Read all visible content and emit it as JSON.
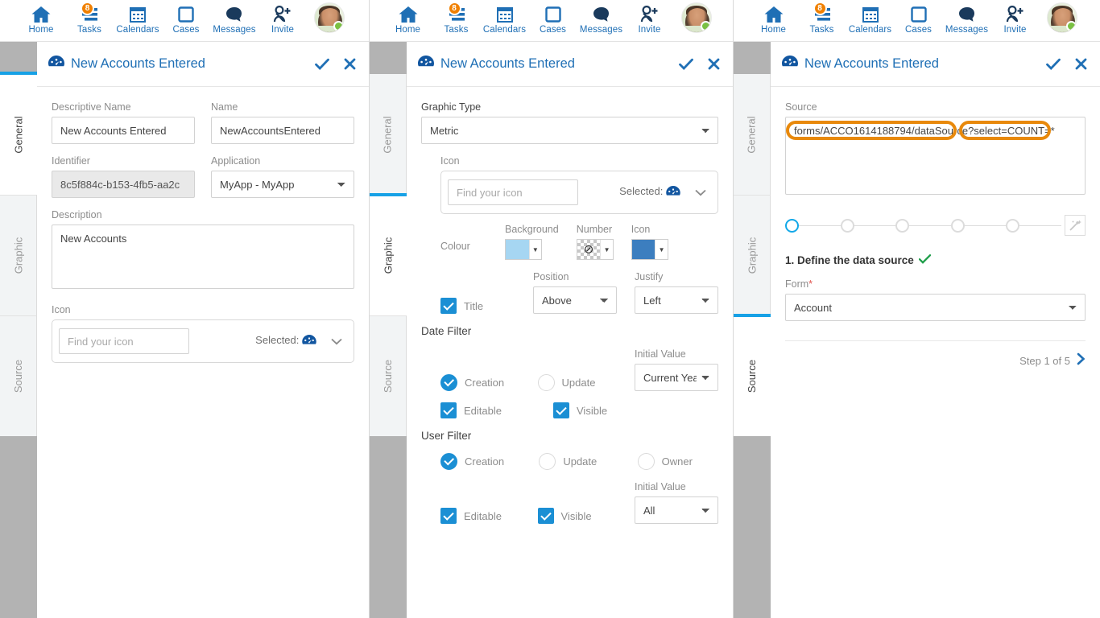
{
  "nav": {
    "items": [
      {
        "label": "Home",
        "icon": "home-icon",
        "badge": null
      },
      {
        "label": "Tasks",
        "icon": "tasks-icon",
        "badge": "8"
      },
      {
        "label": "Calendars",
        "icon": "calendar-icon",
        "badge": null
      },
      {
        "label": "Cases",
        "icon": "cases-icon",
        "badge": null
      },
      {
        "label": "Messages",
        "icon": "message-bubble-icon",
        "badge": null
      },
      {
        "label": "Invite",
        "icon": "invite-user-icon",
        "badge": null
      }
    ],
    "avatar": {
      "name": "avatar",
      "status": "online"
    }
  },
  "window": {
    "title": "New Accounts Entered",
    "icon": "dashboard-gauge-icon",
    "confirm_icon": "checkmark-icon",
    "close_icon": "close-icon"
  },
  "tabs": [
    {
      "label": "General"
    },
    {
      "label": "Graphic"
    },
    {
      "label": "Source"
    }
  ],
  "panel1": {
    "active_tab": "General",
    "descriptive_name": {
      "label": "Descriptive Name",
      "value": "New Accounts Entered"
    },
    "name": {
      "label": "Name",
      "value": "NewAccountsEntered"
    },
    "identifier": {
      "label": "Identifier",
      "value": "8c5f884c-b153-4fb5-aa2c"
    },
    "application": {
      "label": "Application",
      "value": "MyApp - MyApp"
    },
    "description": {
      "label": "Description",
      "value": "New Accounts"
    },
    "icon": {
      "label": "Icon",
      "search_placeholder": "Find your icon",
      "selected_label": "Selected:",
      "selected_icon": "dashboard-gauge-icon"
    }
  },
  "panel2": {
    "active_tab": "Graphic",
    "graphic_type": {
      "label": "Graphic Type",
      "value": "Metric",
      "options": [
        "Metric"
      ]
    },
    "icon": {
      "label": "Icon",
      "search_placeholder": "Find your icon",
      "selected_label": "Selected:",
      "selected_icon": "dashboard-gauge-icon"
    },
    "colour": {
      "label": "Colour",
      "swatches": [
        {
          "caption": "Background",
          "color": "#A6D6F2",
          "transparent": false
        },
        {
          "caption": "Number",
          "color": "transparent",
          "transparent": true
        },
        {
          "caption": "Icon",
          "color": "#3C7EBF",
          "transparent": false
        }
      ]
    },
    "title_row": {
      "checkbox_label": "Title",
      "checkbox_on": true,
      "position": {
        "label": "Position",
        "value": "Above",
        "options": [
          "Above"
        ]
      },
      "justify": {
        "label": "Justify",
        "value": "Left",
        "options": [
          "Left"
        ]
      }
    },
    "date_filter": {
      "title": "Date Filter",
      "radios": [
        {
          "label": "Creation",
          "on": true
        },
        {
          "label": "Update",
          "on": false
        }
      ],
      "initial_value": {
        "label": "Initial Value",
        "value": "Current Year",
        "options": [
          "Current Year"
        ]
      },
      "checks": [
        {
          "label": "Editable",
          "on": true
        },
        {
          "label": "Visible",
          "on": true
        }
      ]
    },
    "user_filter": {
      "title": "User Filter",
      "radios": [
        {
          "label": "Creation",
          "on": true
        },
        {
          "label": "Update",
          "on": false
        },
        {
          "label": "Owner",
          "on": false
        }
      ],
      "initial_value": {
        "label": "Initial Value",
        "value": "All",
        "options": [
          "All"
        ]
      },
      "checks": [
        {
          "label": "Editable",
          "on": true
        },
        {
          "label": "Visible",
          "on": true
        }
      ]
    }
  },
  "panel3": {
    "active_tab": "Source",
    "source": {
      "label": "Source",
      "value": "forms/ACCO1614188794/dataSource?select=COUNT=*",
      "highlights": [
        {
          "text": "forms/ACCO1614188794/dataSource",
          "color": "#E8890C"
        },
        {
          "text": "?select=COUNT=*",
          "color": "#E8890C"
        }
      ]
    },
    "stepper": {
      "total": 5,
      "current": 1,
      "wand_icon": "magic-wand-icon"
    },
    "step_title": "1. Define the data source",
    "step_title_check": "checkmark-icon",
    "form": {
      "label": "Form",
      "required": true,
      "value": "Account",
      "options": [
        "Account"
      ]
    },
    "step_counter": "Step 1 of 5",
    "next_icon": "chevron-right-icon"
  },
  "colors": {
    "accent_blue": "#1f6fb5",
    "active_tab_bar": "#17a1e6",
    "badge_orange": "#f08000",
    "checkbox_blue": "#1b8fd4",
    "highlight_orange": "#E8890C",
    "green_check": "#1f9e4a",
    "status_green": "#7ac143"
  }
}
